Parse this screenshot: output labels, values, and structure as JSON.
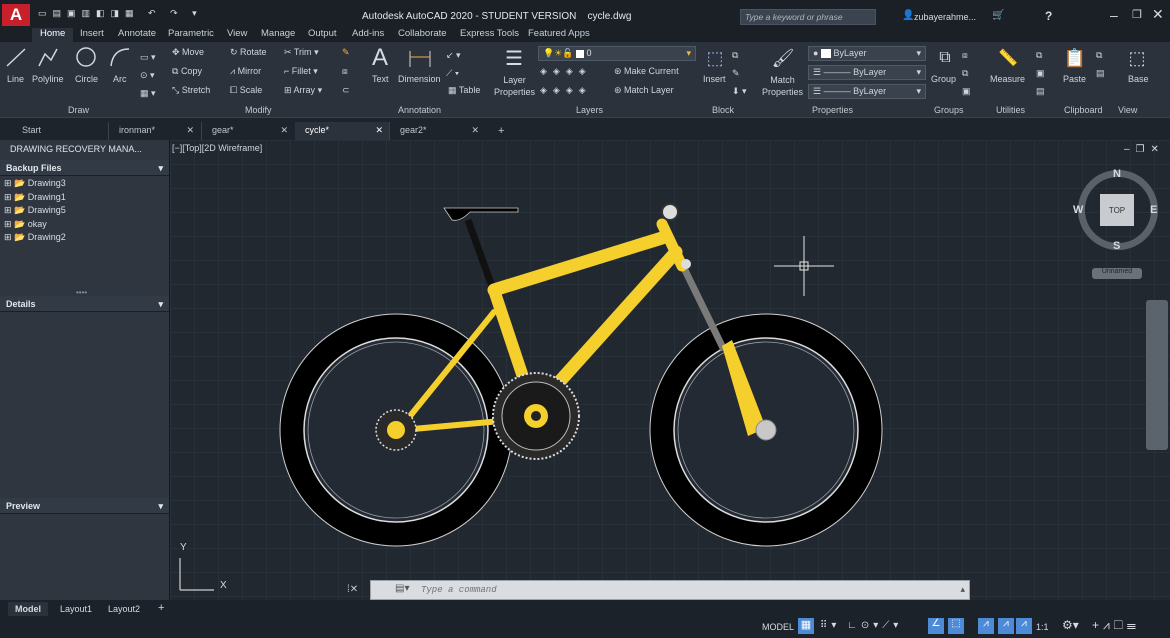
{
  "titlebar": {
    "app_title": "Autodesk AutoCAD 2020 - STUDENT VERSION",
    "filename": "cycle.dwg",
    "search_placeholder": "Type a keyword or phrase",
    "user": "zubayerahme..."
  },
  "ribbon_tabs": [
    "Home",
    "Insert",
    "Annotate",
    "Parametric",
    "View",
    "Manage",
    "Output",
    "Add-ins",
    "Collaborate",
    "Express Tools",
    "Featured Apps"
  ],
  "draw": {
    "line": "Line",
    "polyline": "Polyline",
    "circle": "Circle",
    "arc": "Arc",
    "group": "Draw"
  },
  "modify": {
    "move": "Move",
    "rotate": "Rotate",
    "trim": "Trim",
    "copy": "Copy",
    "mirror": "Mirror",
    "fillet": "Fillet",
    "stretch": "Stretch",
    "scale": "Scale",
    "array": "Array",
    "group": "Modify"
  },
  "annotation": {
    "text": "Text",
    "dimension": "Dimension",
    "table": "Table",
    "group": "Annotation"
  },
  "layers": {
    "layer_props": "Layer",
    "layer_props2": "Properties",
    "current_layer": "0",
    "make_current": "Make Current",
    "match_layer": "Match Layer",
    "group": "Layers"
  },
  "block": {
    "insert": "Insert",
    "group": "Block"
  },
  "properties": {
    "match": "Match",
    "match2": "Properties",
    "bylayer1": "ByLayer",
    "bylayer2": "ByLayer",
    "bylayer3": "ByLayer",
    "group": "Properties"
  },
  "groups": {
    "group": "Group",
    "label": "Groups"
  },
  "utilities": {
    "measure": "Measure",
    "label": "Utilities"
  },
  "clipboard": {
    "paste": "Paste",
    "label": "Clipboard"
  },
  "view": {
    "base": "Base",
    "label": "View"
  },
  "doc_tabs": [
    "Start",
    "ironman*",
    "gear*",
    "cycle*",
    "gear2*"
  ],
  "left_panel": {
    "title": "DRAWING RECOVERY MANA...",
    "backup": "Backup Files",
    "files": [
      "Drawing3",
      "Drawing1",
      "Drawing5",
      "okay",
      "Drawing2"
    ],
    "details": "Details",
    "preview": "Preview"
  },
  "viewport": {
    "label": "[−][Top][2D Wireframe]"
  },
  "viewcube": {
    "n": "N",
    "s": "S",
    "e": "E",
    "w": "W",
    "top": "TOP",
    "wcs": "Unnamed"
  },
  "ucs": {
    "x": "X",
    "y": "Y"
  },
  "command": {
    "placeholder": "Type a command"
  },
  "layout_tabs": [
    "Model",
    "Layout1",
    "Layout2"
  ],
  "status": {
    "model": "MODEL",
    "scale": "1:1"
  },
  "colors": {
    "bike_yellow": "#f5cf2c",
    "accent": "#4d8bd6",
    "bg": "#212830"
  }
}
